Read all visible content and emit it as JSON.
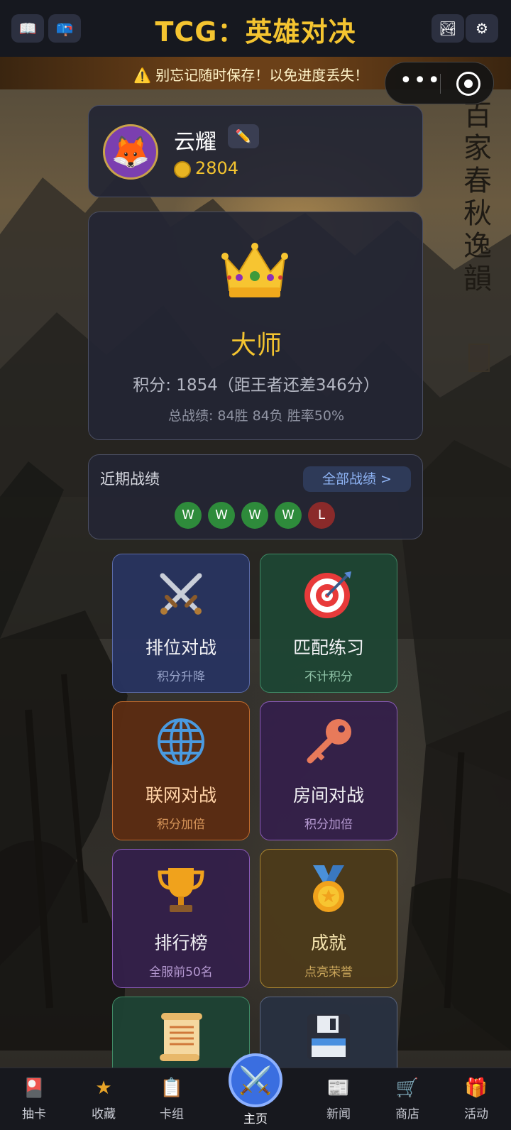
{
  "header": {
    "title": "TCG：英雄对决",
    "left_icons": [
      "book-icon",
      "mailbox-icon"
    ],
    "right_icons": [
      "landscape-icon",
      "gear-icon"
    ]
  },
  "banner": {
    "text": "⚠️ 别忘记随时保存！以免进度丢失！"
  },
  "background": {
    "vertical_text": "百家春秋逸韻"
  },
  "profile": {
    "name": "云耀",
    "edit_icon": "pencil-icon",
    "coins": "2804",
    "avatar_icon": "fox-icon"
  },
  "rank": {
    "icon": "crown-icon",
    "name": "大师",
    "score": "积分: 1854（距王者还差346分）",
    "record": "总战绩: 84胜 84负  胜率50%"
  },
  "recent": {
    "title": "近期战绩",
    "all_label": "全部战绩 >",
    "results": [
      "W",
      "W",
      "W",
      "W",
      "L"
    ]
  },
  "modes": [
    {
      "title": "排位对战",
      "subtitle": "积分升降",
      "icon": "crossed-swords-icon"
    },
    {
      "title": "匹配练习",
      "subtitle": "不计积分",
      "icon": "target-icon"
    },
    {
      "title": "联网对战",
      "subtitle": "积分加倍",
      "icon": "globe-icon"
    },
    {
      "title": "房间对战",
      "subtitle": "积分加倍",
      "icon": "key-icon"
    },
    {
      "title": "排行榜",
      "subtitle": "全服前50名",
      "icon": "trophy-icon"
    },
    {
      "title": "成就",
      "subtitle": "点亮荣誉",
      "icon": "medal-icon"
    },
    {
      "title": "",
      "subtitle": "",
      "icon": "scroll-icon"
    },
    {
      "title": "",
      "subtitle": "",
      "icon": "floppy-disk-icon"
    }
  ],
  "nav": [
    {
      "label": "抽卡",
      "icon": "card-draw-icon"
    },
    {
      "label": "收藏",
      "icon": "star-icon"
    },
    {
      "label": "卡组",
      "icon": "clipboard-icon"
    },
    {
      "label": "主页",
      "icon": "crossed-swords-icon"
    },
    {
      "label": "新闻",
      "icon": "newspaper-icon"
    },
    {
      "label": "商店",
      "icon": "cart-icon"
    },
    {
      "label": "活动",
      "icon": "gift-icon"
    }
  ],
  "colors": {
    "accent_gold": "#f4c430",
    "win": "#2e8b3b",
    "loss": "#8a2a2a",
    "home": "#3a6ee0"
  }
}
